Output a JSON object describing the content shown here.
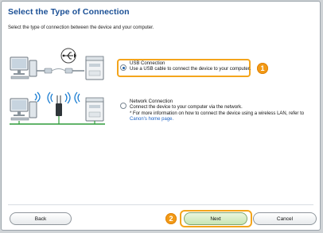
{
  "title": "Select the Type of Connection",
  "subtitle": "Select the type of connection between the device and your computer.",
  "options": [
    {
      "label": "USB Connection",
      "description": "Use a USB cable to connect the device to your computer.",
      "selected": true,
      "badge": "1"
    },
    {
      "label": "Network Connection",
      "description": "Connect the device to your computer via the network.",
      "note": "* For more information on how to connect the device using a wireless LAN, refer to",
      "link": "Canon's home page.",
      "selected": false
    }
  ],
  "buttons": {
    "back": "Back",
    "next": "Next",
    "cancel": "Cancel",
    "next_badge": "2"
  },
  "colors": {
    "accent": "#f29a16",
    "title": "#1a4f95",
    "link": "#1d63c6"
  }
}
